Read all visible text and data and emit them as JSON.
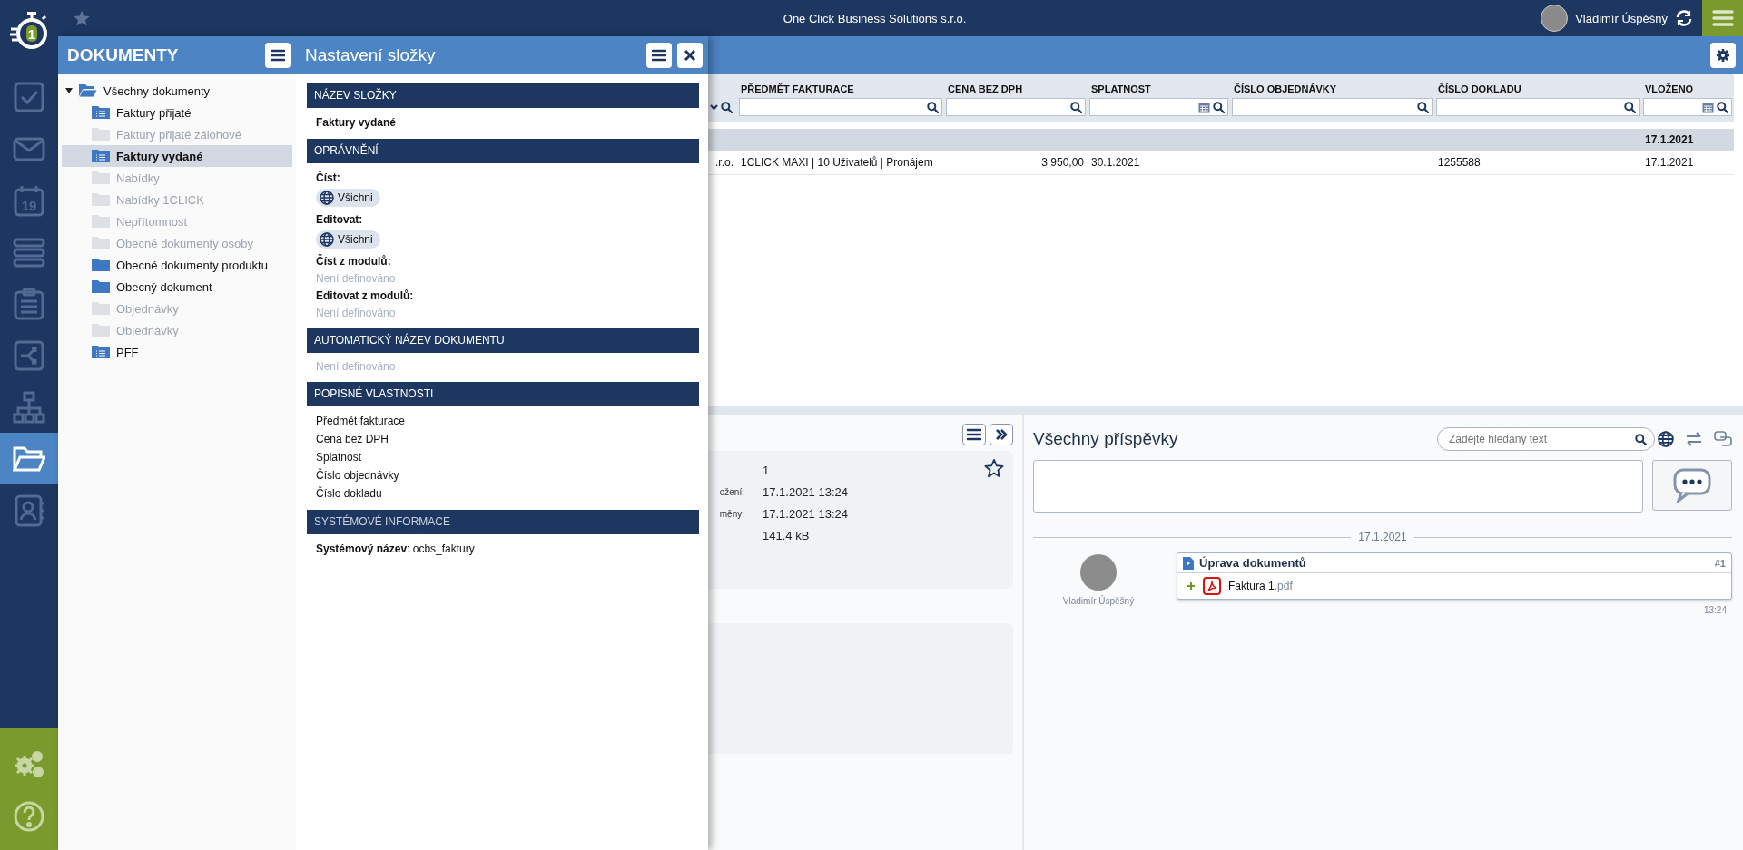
{
  "top_bar": {
    "logo_text": "1",
    "company": "One Click Business Solutions s.r.o.",
    "user": "Vladimír Úspěšný"
  },
  "rail": {
    "items": [
      {
        "kind": "tasks",
        "selected": false
      },
      {
        "kind": "mail",
        "selected": false
      },
      {
        "kind": "calendar",
        "label": "19",
        "selected": false
      },
      {
        "kind": "stack",
        "selected": false
      },
      {
        "kind": "clipboard",
        "selected": false
      },
      {
        "kind": "share",
        "selected": false
      },
      {
        "kind": "org",
        "selected": false
      },
      {
        "kind": "folder",
        "selected": true
      },
      {
        "kind": "contacts",
        "selected": false
      }
    ],
    "bottom": [
      {
        "kind": "settings"
      },
      {
        "kind": "help"
      }
    ]
  },
  "documents_panel": {
    "title": "DOKUMENTY",
    "tree": [
      {
        "label": "Všechny dokumenty",
        "expanded": true,
        "kind": "open",
        "disabled": false,
        "selected": false,
        "children": [
          {
            "label": "Faktury přijaté",
            "kind": "list",
            "disabled": false,
            "selected": false
          },
          {
            "label": "Faktury přijaté zálohové",
            "kind": "plain",
            "disabled": true,
            "selected": false
          },
          {
            "label": "Faktury vydané",
            "kind": "list",
            "disabled": false,
            "selected": true
          },
          {
            "label": "Nabídky",
            "kind": "plain",
            "disabled": true,
            "selected": false
          },
          {
            "label": "Nabídky 1CLICK",
            "kind": "plain",
            "disabled": true,
            "selected": false
          },
          {
            "label": "Nepřítomnost",
            "kind": "plain",
            "disabled": true,
            "selected": false
          },
          {
            "label": "Obecné dokumenty osoby",
            "kind": "plain",
            "disabled": true,
            "selected": false
          },
          {
            "label": "Obecné dokumenty produktu",
            "kind": "plain",
            "disabled": false,
            "selected": false
          },
          {
            "label": "Obecný dokument",
            "kind": "plain",
            "disabled": false,
            "selected": false
          },
          {
            "label": "Objednávky",
            "kind": "plain",
            "disabled": true,
            "selected": false
          },
          {
            "label": "Objednávky",
            "kind": "plain",
            "disabled": true,
            "selected": false
          },
          {
            "label": "PFF",
            "kind": "list",
            "disabled": false,
            "selected": false
          }
        ]
      }
    ]
  },
  "folder_settings": {
    "title": "Nastavení složky",
    "sections": [
      {
        "heading": "NÁZEV SLOŽKY",
        "items": [
          {
            "kind": "value",
            "text": "Faktury vydané"
          }
        ]
      },
      {
        "heading": "OPRÁVNĚNÍ",
        "items": [
          {
            "kind": "label",
            "text": "Číst:"
          },
          {
            "kind": "chip",
            "text": "Všichni"
          },
          {
            "kind": "label",
            "text": "Editovat:"
          },
          {
            "kind": "chip",
            "text": "Všichni"
          },
          {
            "kind": "label",
            "text": "Číst z modulů:"
          },
          {
            "kind": "empty",
            "text": "Není definováno"
          },
          {
            "kind": "label",
            "text": "Editovat z modulů:"
          },
          {
            "kind": "empty",
            "text": "Není definováno"
          }
        ]
      },
      {
        "heading": "AUTOMATICKÝ NÁZEV DOKUMENTU",
        "items": [
          {
            "kind": "empty",
            "text": "Není definováno"
          }
        ]
      },
      {
        "heading": "POPISNÉ VLASTNOSTI",
        "items": [
          {
            "kind": "plain",
            "text": "Předmět fakturace"
          },
          {
            "kind": "plain",
            "text": "Cena bez DPH"
          },
          {
            "kind": "plain",
            "text": "Splatnost"
          },
          {
            "kind": "plain",
            "text": "Číslo objednávky"
          },
          {
            "kind": "plain",
            "text": "Číslo dokladu"
          }
        ]
      },
      {
        "heading": "SYSTÉMOVÉ INFORMACE",
        "items": [
          {
            "kind": "pair",
            "text": "**Systémový název**: ocbs_faktury"
          }
        ]
      }
    ]
  },
  "table": {
    "columns": [
      {
        "kind": "select"
      },
      {
        "label": "PŘEDMĚT FAKTURACE",
        "kind": "search"
      },
      {
        "label": "CENA BEZ DPH",
        "kind": "search"
      },
      {
        "label": "SPLATNOST",
        "kind": "date"
      },
      {
        "label": "ČÍSLO OBJEDNÁVKY",
        "kind": "search"
      },
      {
        "label": "ČÍSLO DOKLADU",
        "kind": "search"
      },
      {
        "label": "VLOŽENO",
        "kind": "date"
      }
    ],
    "group_row": {
      "label": "17.1.2021"
    },
    "rows": [
      {
        "cells": [
          ".r.o.",
          "1CLICK MAXI | 10 Uživatelů | Pronájem",
          "3 950,00",
          "30.1.2021",
          "",
          "1255588",
          "17.1.2021"
        ]
      }
    ]
  },
  "detail": {
    "starred": false,
    "fields": [
      {
        "value": "1"
      },
      {
        "label": "ožení:",
        "value": "17.1.2021 13:24"
      },
      {
        "label": "měny:",
        "value": "17.1.2021 13:24"
      },
      {
        "value": "141.4 kB"
      }
    ]
  },
  "comments": {
    "title": "Všechny příspěvky",
    "search": {
      "placeholder": "Zadejte hledaný text"
    },
    "date_divider": "17.1.2021",
    "posts": [
      {
        "author": "Vladimír Úspěšný",
        "title": "Úprava dokumentů",
        "number": "#1",
        "time": "13:24",
        "attachments": [
          {
            "name": "Faktura 1",
            "ext": ".pdf"
          }
        ]
      }
    ]
  }
}
